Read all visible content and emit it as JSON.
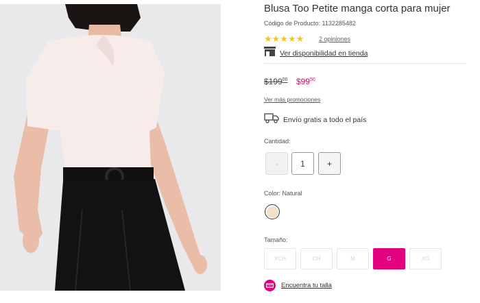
{
  "product": {
    "title": "Blusa Too Petite manga corta para mujer",
    "sku": "Código de Producto: 1132285482",
    "stars": "★★★★★",
    "reviews_link": "2 opiniones",
    "store_link": "Ver disponibilidad en tienda",
    "store_icon": "store-icon"
  },
  "price": {
    "old_main": "$199",
    "old_cents": "00",
    "new_main": "$99",
    "new_cents": "50",
    "promos_link": "Ver más promociones"
  },
  "shipping": {
    "text": "Envío gratis a todo el país",
    "icon": "truck-icon"
  },
  "quantity": {
    "label": "Cantidad:",
    "minus": "-",
    "value": "1",
    "plus": "+"
  },
  "color": {
    "label": "Color: Natural",
    "swatch_hex": "#f4dfc8"
  },
  "size": {
    "label": "Tamaño:",
    "options": [
      "XCH",
      "CH",
      "M",
      "G",
      "XG"
    ],
    "selected": "G"
  },
  "fit": {
    "link": "Encuentra tu talla",
    "icon": "ruler-icon"
  },
  "colors": {
    "accent": "#e3007e",
    "sale_price": "#e3006d",
    "stars": "#f5c518"
  }
}
